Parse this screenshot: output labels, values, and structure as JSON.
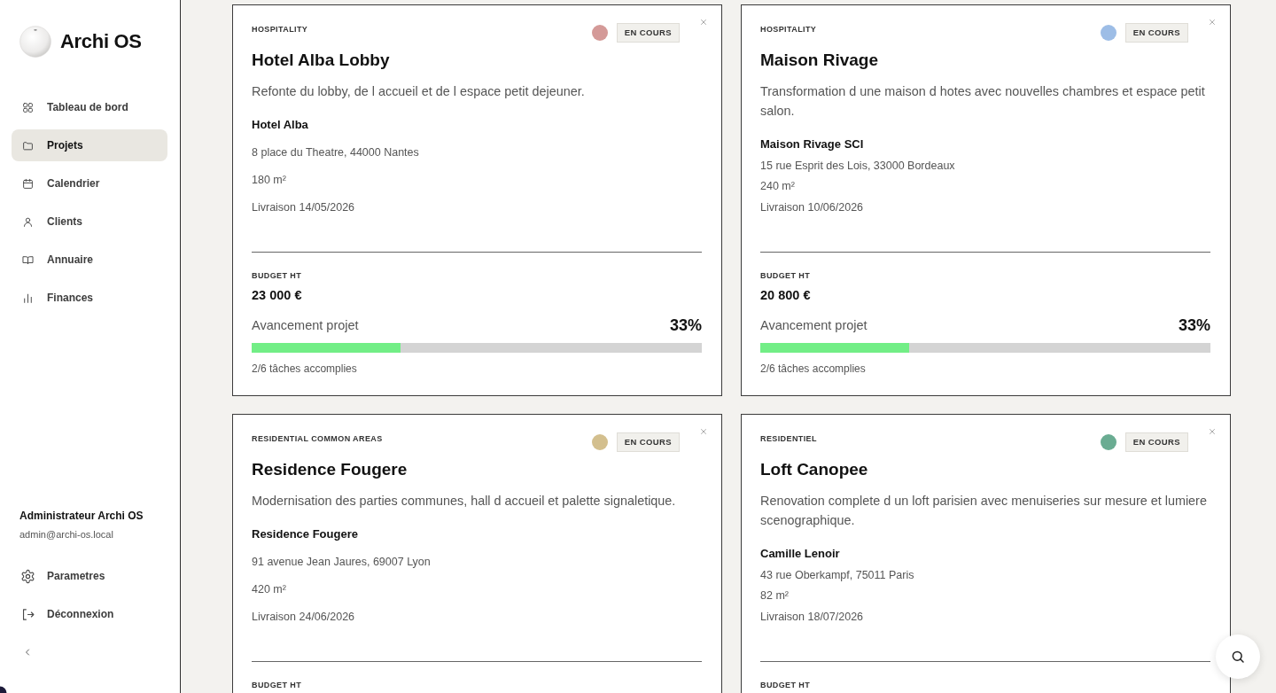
{
  "app": {
    "name": "Archi OS"
  },
  "sidebar": {
    "items": [
      {
        "label": "Tableau de bord",
        "selected": false
      },
      {
        "label": "Projets",
        "selected": true
      },
      {
        "label": "Calendrier",
        "selected": false
      },
      {
        "label": "Clients",
        "selected": false
      },
      {
        "label": "Annuaire",
        "selected": false
      },
      {
        "label": "Finances",
        "selected": false
      }
    ],
    "user": {
      "name": "Administrateur Archi OS",
      "email": "admin@archi-os.local"
    },
    "footer_items": [
      {
        "label": "Parametres"
      },
      {
        "label": "Déconnexion"
      }
    ]
  },
  "projects": [
    {
      "category": "HOSPITALITY",
      "color": "#d49a98",
      "status": "EN COURS",
      "title": "Hotel Alba Lobby",
      "description": "Refonte du lobby, de l accueil et de l espace petit dejeuner.",
      "client": "Hotel Alba",
      "address": "8 place du Theatre, 44000 Nantes",
      "area": "180 m²",
      "delivery": "Livraison 14/05/2026",
      "budget_label": "BUDGET HT",
      "budget": "23 000 €",
      "progress_label": "Avancement projet",
      "progress_value": "33%",
      "level": 0.33,
      "tasks": "2/6 tâches accomplies"
    },
    {
      "category": "HOSPITALITY",
      "color": "#9dbde6",
      "status": "EN COURS",
      "title": "Maison Rivage",
      "description": "Transformation d une maison d hotes avec nouvelles chambres et espace petit salon.",
      "client": "Maison Rivage SCI",
      "address": "15 rue Esprit des Lois, 33000 Bordeaux",
      "area": "240 m²",
      "delivery": "Livraison 10/06/2026",
      "budget_label": "BUDGET HT",
      "budget": "20 800 €",
      "progress_label": "Avancement projet",
      "progress_value": "33%",
      "level": 0.33,
      "tasks": "2/6 tâches accomplies"
    },
    {
      "category": "RESIDENTIAL COMMON AREAS",
      "color": "#d3bf8e",
      "status": "EN COURS",
      "title": "Residence Fougere",
      "description": "Modernisation des parties communes, hall d accueil et palette signaletique.",
      "client": "Residence Fougere",
      "address": "91 avenue Jean Jaures, 69007 Lyon",
      "area": "420 m²",
      "delivery": "Livraison 24/06/2026",
      "budget_label": "BUDGET HT"
    },
    {
      "category": "RESIDENTIEL",
      "color": "#6aac92",
      "status": "EN COURS",
      "title": "Loft Canopee",
      "description": "Renovation complete d un loft parisien avec menuiseries sur mesure et lumiere scenographique.",
      "client": "Camille Lenoir",
      "address": "43 rue Oberkampf, 75011 Paris",
      "area": "82 m²",
      "delivery": "Livraison 18/07/2026",
      "budget_label": "BUDGET HT"
    }
  ]
}
